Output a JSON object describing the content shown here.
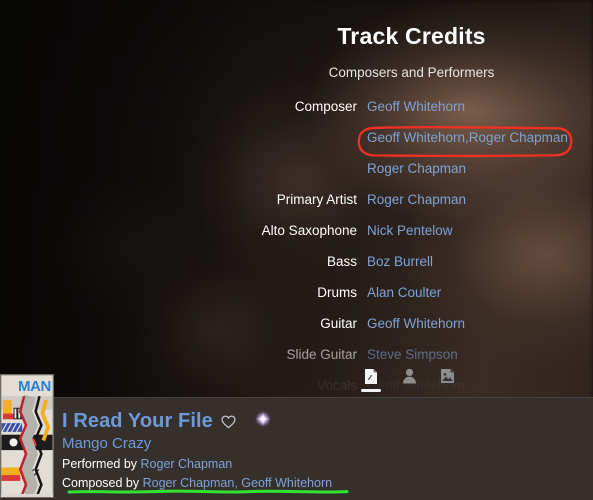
{
  "credits": {
    "title": "Track Credits",
    "subtitle": "Composers and Performers",
    "rows": [
      {
        "label": "Composer",
        "value": "Geoff Whitehorn"
      },
      {
        "label": "",
        "value": "Geoff Whitehorn,Roger Chapman"
      },
      {
        "label": "",
        "value": "Roger Chapman"
      },
      {
        "label": "Primary Artist",
        "value": "Roger Chapman"
      },
      {
        "label": "Alto Saxophone",
        "value": "Nick Pentelow"
      },
      {
        "label": "Bass",
        "value": "Boz Burrell"
      },
      {
        "label": "Drums",
        "value": "Alan Coulter"
      },
      {
        "label": "Guitar",
        "value": "Steve Simpson"
      },
      {
        "label": "Guitar",
        "value": "Geoff Whitehorn"
      },
      {
        "label": "Slide Guitar",
        "value": "Steve Simpson"
      },
      {
        "label": "Vocals",
        "value": "Geoff Whitehorn"
      }
    ]
  },
  "rows_visible": [
    {
      "label": "Composer",
      "value": "Geoff Whitehorn"
    },
    {
      "label": "",
      "value": "Geoff Whitehorn,Roger Chapman"
    },
    {
      "label": "",
      "value": "Roger Chapman"
    },
    {
      "label": "Primary Artist",
      "value": "Roger Chapman"
    },
    {
      "label": "Alto Saxophone",
      "value": "Nick Pentelow"
    },
    {
      "label": "Bass",
      "value": "Boz Burrell"
    },
    {
      "label": "Drums",
      "value": "Alan Coulter"
    },
    {
      "label": "Guitar",
      "value": "Geoff Whitehorn"
    },
    {
      "label": "Slide Guitar",
      "value": "Steve Simpson"
    },
    {
      "label": "Vocals",
      "value": "Geoff Whitehorn"
    }
  ],
  "tabs": [
    {
      "icon": "lyrics-page-icon",
      "active": true
    },
    {
      "icon": "person-icon",
      "active": false
    },
    {
      "icon": "image-icon",
      "active": false
    }
  ],
  "player": {
    "album_art_text": "MAN",
    "track_title": "I Read Your File",
    "favorite_icon": "heart-outline-icon",
    "sparkle_icon": "sparkle-icon",
    "album_name": "Mango Crazy",
    "performed_label": "Performed by",
    "performed_by": "Roger Chapman",
    "composed_label": "Composed by",
    "composed_by_1": "Roger Chapman",
    "composed_separator": ", ",
    "composed_by_2": "Geoff Whitehorn"
  },
  "annotations": {
    "highlight_box_color": "#ef3124",
    "underline_color": "#2ee62e",
    "highlight_target": "Geoff Whitehorn,Roger Chapman",
    "underline_target": "Composed by Roger Chapman, Geoff Whitehorn"
  },
  "colors": {
    "link_blue": "#7ea3d6",
    "title_blue": "#6f9ada",
    "text_white": "#ffffff",
    "player_bg": "#36302d",
    "backdrop_dark": "#141110"
  }
}
